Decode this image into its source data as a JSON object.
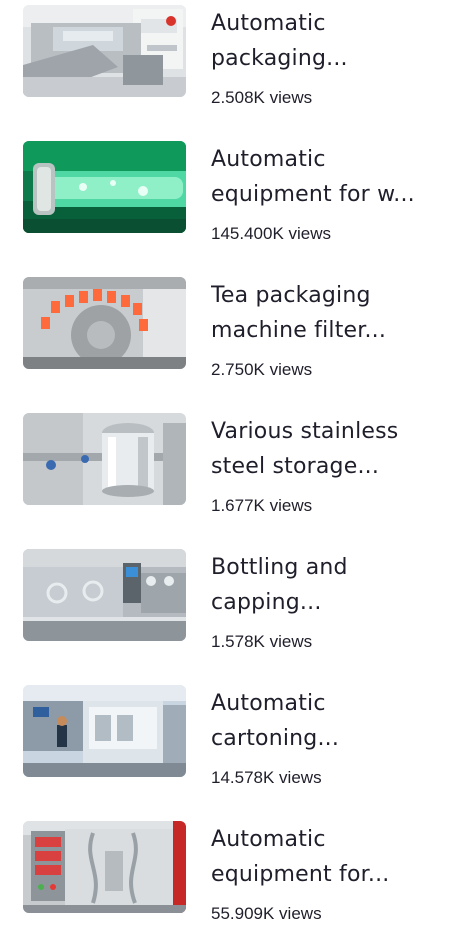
{
  "videos": [
    {
      "title_line1": "Automatic",
      "title_line2": "packaging...",
      "views": "2.508K views",
      "thumbnail_icon": "packaging-machine-thumbnail"
    },
    {
      "title_line1": "Automatic",
      "title_line2": "equipment for w...",
      "views": "145.400K views",
      "thumbnail_icon": "green-liquid-pipe-thumbnail"
    },
    {
      "title_line1": "Tea packaging",
      "title_line2": "machine filter...",
      "views": "2.750K views",
      "thumbnail_icon": "tea-packaging-wheel-thumbnail"
    },
    {
      "title_line1": "Various stainless",
      "title_line2": "steel storage...",
      "views": "1.677K views",
      "thumbnail_icon": "stainless-tank-thumbnail"
    },
    {
      "title_line1": "Bottling and",
      "title_line2": "capping...",
      "views": "1.578K views",
      "thumbnail_icon": "bottling-machine-thumbnail"
    },
    {
      "title_line1": "Automatic",
      "title_line2": "cartoning...",
      "views": "14.578K views",
      "thumbnail_icon": "cartoning-machine-thumbnail"
    },
    {
      "title_line1": "Automatic",
      "title_line2": "equipment for...",
      "views": "55.909K views",
      "thumbnail_icon": "filling-equipment-thumbnail"
    }
  ],
  "colors": {
    "text": "#1f1f2b",
    "background": "#ffffff"
  }
}
